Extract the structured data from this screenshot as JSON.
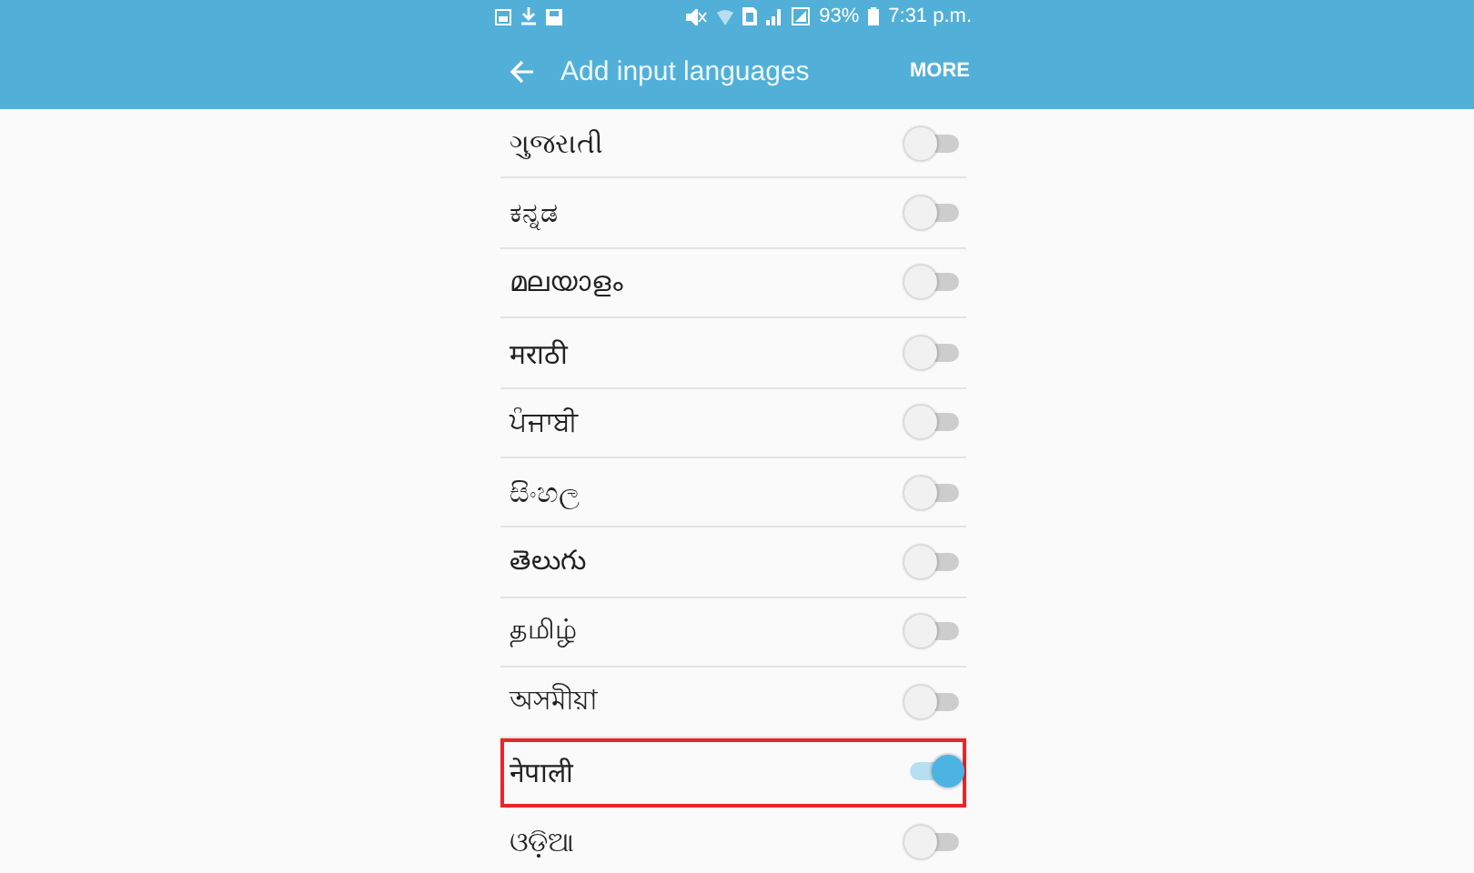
{
  "status_bar": {
    "battery_percent": "93%",
    "time": "7:31 p.m."
  },
  "app_bar": {
    "title": "Add input languages",
    "action": "MORE"
  },
  "languages": [
    {
      "name": "ગુજરાતી",
      "on": false,
      "highlighted": false
    },
    {
      "name": "ಕನ್ನಡ",
      "on": false,
      "highlighted": false
    },
    {
      "name": "മലയാളം",
      "on": false,
      "highlighted": false
    },
    {
      "name": "मराठी",
      "on": false,
      "highlighted": false
    },
    {
      "name": "ਪੰਜਾਬੀ",
      "on": false,
      "highlighted": false
    },
    {
      "name": "සිංහල",
      "on": false,
      "highlighted": false
    },
    {
      "name": "తెలుగు",
      "on": false,
      "highlighted": false
    },
    {
      "name": "தமிழ்",
      "on": false,
      "highlighted": false
    },
    {
      "name": "অসমীয়া",
      "on": false,
      "highlighted": false
    },
    {
      "name": "नेपाली",
      "on": true,
      "highlighted": true
    },
    {
      "name": "ଓଡ଼ିଆ",
      "on": false,
      "highlighted": false
    }
  ]
}
